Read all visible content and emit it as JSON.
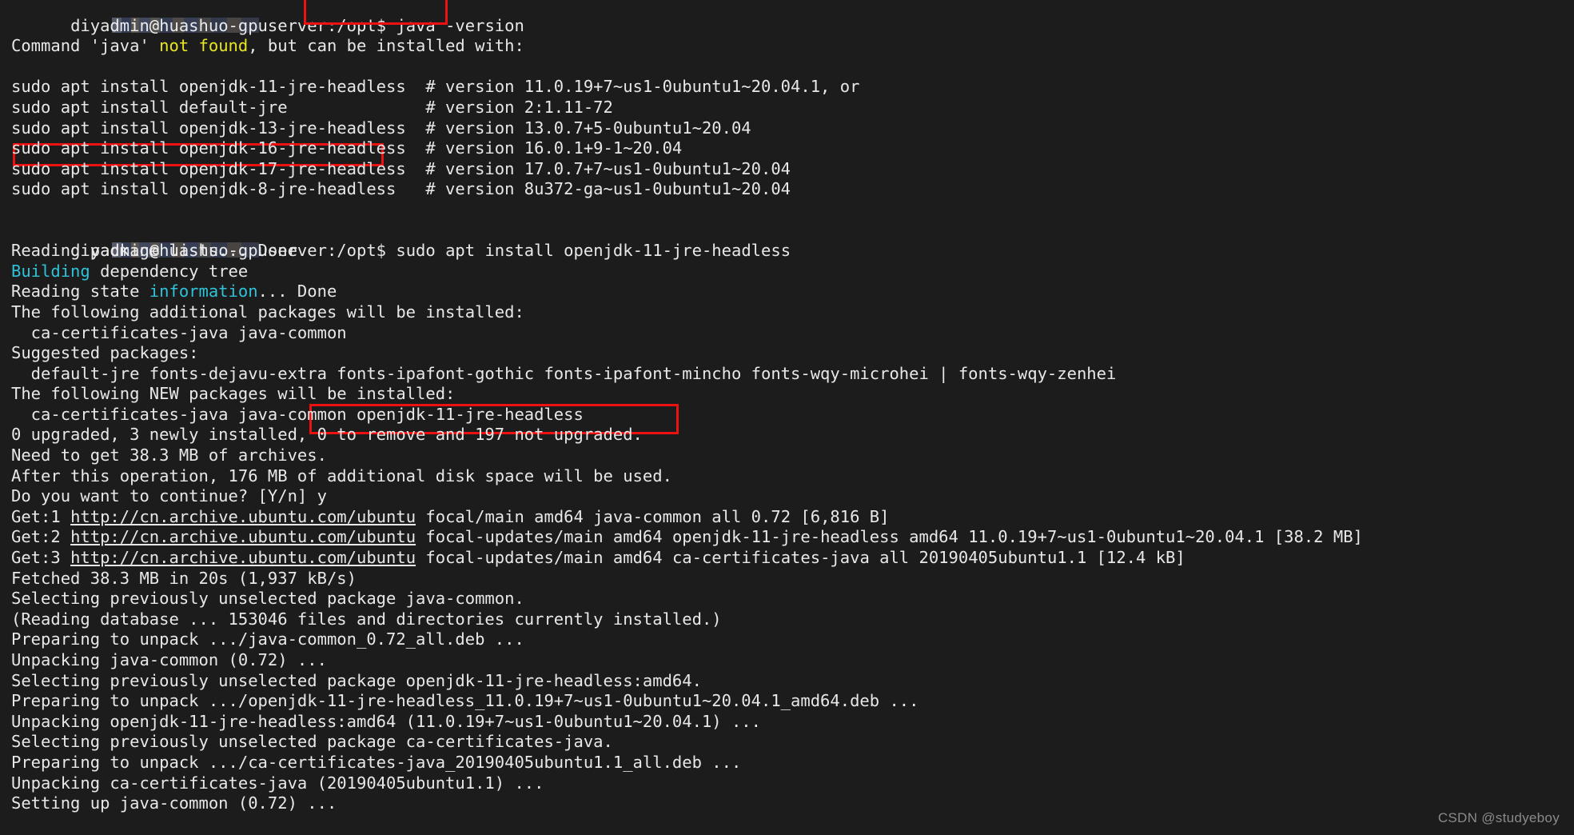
{
  "terminal": {
    "background_color": "#1c1c1c",
    "foreground_color": "#e8e8e8",
    "accent_colors": {
      "yellow": "#e7e721",
      "cyan": "#2fc2d9",
      "annotation_red": "#ee1111"
    },
    "prompt": "diyadmin@huashuo-gpuserver:/opt$",
    "commands": {
      "java_version": "java -version",
      "apt_install": "sudo apt install openjdk-11-jre-headless"
    },
    "lines": {
      "l01_prompt": "diyadmin@huashuo-gpuserver:/opt$ ",
      "l01_cmd": "java -version",
      "l02_a": "Command 'java' ",
      "l02_b": "not found",
      "l02_c": ", but can be installed with:",
      "l03": "sudo apt install openjdk-11-jre-headless  # version 11.0.19+7~us1-0ubuntu1~20.04.1, or",
      "l04": "sudo apt install default-jre              # version 2:1.11-72",
      "l05": "sudo apt install openjdk-13-jre-headless  # version 13.0.7+5-0ubuntu1~20.04",
      "l06": "sudo apt install openjdk-16-jre-headless  # version 16.0.1+9-1~20.04",
      "l07": "sudo apt install openjdk-17-jre-headless  # version 17.0.7+7~us1-0ubuntu1~20.04",
      "l08": "sudo apt install openjdk-8-jre-headless   # version 8u372-ga~us1-0ubuntu1~20.04",
      "l09_prompt": "diyadmin@huashuo-gpuserver:/opt$ ",
      "l09_cmd": "sudo apt install openjdk-11-jre-headless",
      "l10": "Reading package lists... Done",
      "l11_a": "Building",
      "l11_b": " dependency tree",
      "l12_a": "Reading state ",
      "l12_b": "information",
      "l12_c": "... Done",
      "l13": "The following additional packages will be installed:",
      "l14": "  ca-certificates-java java-common",
      "l15": "Suggested packages:",
      "l16": "  default-jre fonts-dejavu-extra fonts-ipafont-gothic fonts-ipafont-mincho fonts-wqy-microhei | fonts-wqy-zenhei",
      "l17": "The following NEW packages will be installed:",
      "l18": "  ca-certificates-java java-common openjdk-11-jre-headless",
      "l19": "0 upgraded, 3 newly installed, 0 to remove and 197 not upgraded.",
      "l20": "Need to get 38.3 MB of archives.",
      "l21": "After this operation, 176 MB of additional disk space will be used.",
      "l22": "Do you want to continue? [Y/n] y",
      "l23_a": "Get:1 ",
      "l23_url": "http://cn.archive.ubuntu.com/ubuntu",
      "l23_b": " focal/main amd64 java-common all 0.72 [6,816 B]",
      "l24_a": "Get:2 ",
      "l24_url": "http://cn.archive.ubuntu.com/ubuntu",
      "l24_b": " focal-updates/main amd64 openjdk-11-jre-headless amd64 11.0.19+7~us1-0ubuntu1~20.04.1 [38.2 MB]",
      "l25_a": "Get:3 ",
      "l25_url": "http://cn.archive.ubuntu.com/ubuntu",
      "l25_b": " focal-updates/main amd64 ca-certificates-java all 20190405ubuntu1.1 [12.4 kB]",
      "l26": "Fetched 38.3 MB in 20s (1,937 kB/s)",
      "l27": "Selecting previously unselected package java-common.",
      "l28": "(Reading database ... 153046 files and directories currently installed.)",
      "l29": "Preparing to unpack .../java-common_0.72_all.deb ...",
      "l30": "Unpacking java-common (0.72) ...",
      "l31": "Selecting previously unselected package openjdk-11-jre-headless:amd64.",
      "l32": "Preparing to unpack .../openjdk-11-jre-headless_11.0.19+7~us1-0ubuntu1~20.04.1_amd64.deb ...",
      "l33": "Unpacking openjdk-11-jre-headless:amd64 (11.0.19+7~us1-0ubuntu1~20.04.1) ...",
      "l34": "Selecting previously unselected package ca-certificates-java.",
      "l35": "Preparing to unpack .../ca-certificates-java_20190405ubuntu1.1_all.deb ...",
      "l36": "Unpacking ca-certificates-java (20190405ubuntu1.1) ...",
      "l37": "Setting up java-common (0.72) ..."
    }
  },
  "watermark": {
    "text": "CSDN @studyeboy"
  }
}
